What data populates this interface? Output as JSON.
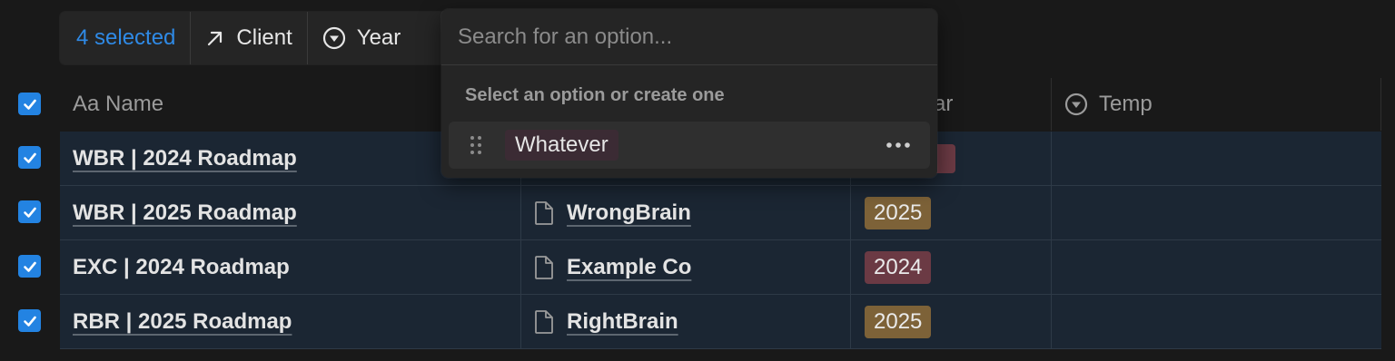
{
  "action_bar": {
    "selected_label": "4 selected",
    "client_label": "Client",
    "year_label": "Year"
  },
  "headers": {
    "name_label": "Aa Name",
    "year_partial": "ar",
    "temp_label": "Temp"
  },
  "rows": [
    {
      "name": "WBR | 2024 Roadmap",
      "client": "",
      "year": ""
    },
    {
      "name": "WBR | 2025 Roadmap",
      "client": "WrongBrain",
      "year": "2025"
    },
    {
      "name": "EXC | 2024 Roadmap",
      "client": "Example Co",
      "year": "2024"
    },
    {
      "name": "RBR | 2025 Roadmap",
      "client": "RightBrain",
      "year": "2025"
    }
  ],
  "dropdown": {
    "search_placeholder": "Search for an option...",
    "hint": "Select an option or create one",
    "option_label": "Whatever"
  },
  "colors": {
    "accent": "#2f8ae6",
    "checkbox": "#2383e2",
    "tag_2025": "#7d6238",
    "tag_2024": "#6b3a44",
    "option_tag": "#3b2b34"
  }
}
